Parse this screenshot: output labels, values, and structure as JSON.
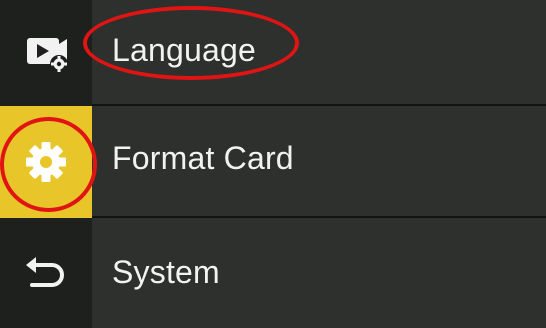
{
  "sidebar": {
    "items": [
      {
        "icon": "video-settings-icon",
        "active": false
      },
      {
        "icon": "gear-icon",
        "active": true
      },
      {
        "icon": "back-arrow-icon",
        "active": false
      }
    ],
    "active_color": "#e8c62a"
  },
  "menu": {
    "items": [
      {
        "label": "Language"
      },
      {
        "label": "Format Card"
      },
      {
        "label": "System"
      }
    ]
  },
  "annotations": {
    "color": "#e11414",
    "highlighted": [
      "Language",
      "gear-icon"
    ]
  }
}
